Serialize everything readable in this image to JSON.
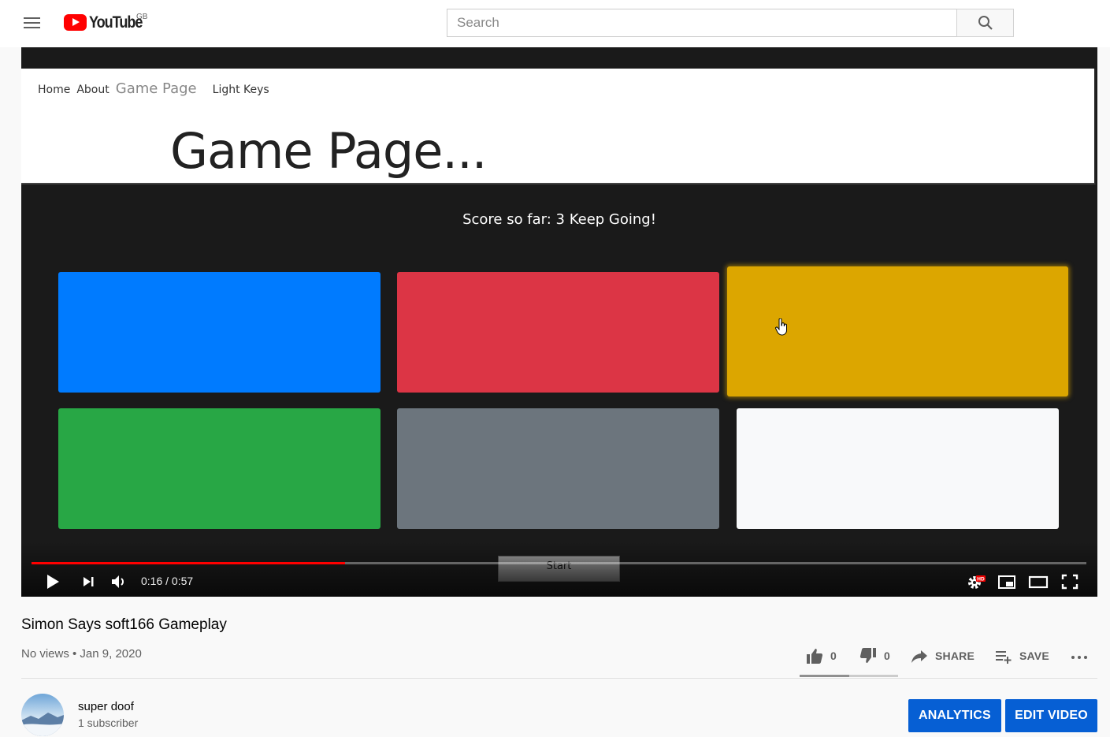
{
  "masthead": {
    "logo_text": "YouTube",
    "region": "GB",
    "search_placeholder": "Search"
  },
  "player": {
    "site_nav": [
      {
        "label": "Home"
      },
      {
        "label": "About"
      },
      {
        "label": "Game Page"
      },
      {
        "label": "Light Keys"
      }
    ],
    "site_heading": "Game Page...",
    "score_text": "Score so far: 3 Keep Going!",
    "start_label": "Start",
    "current_time": "0:16",
    "duration": "0:57",
    "time_display": "0:16 / 0:57",
    "progress_fraction": 0.297,
    "tile_colors": {
      "blue": "#007bff",
      "red": "#dc3545",
      "yellow": "#dca600",
      "green": "#28a745",
      "gray": "#6c757d",
      "white": "#f8f9fa"
    },
    "hd_badge": "HD"
  },
  "video": {
    "title": "Simon Says soft166 Gameplay",
    "meta": "No views • Jan 9, 2020",
    "likes": "0",
    "dislikes": "0",
    "share_label": "SHARE",
    "save_label": "SAVE",
    "like_ratio": 0.5
  },
  "channel": {
    "name": "super doof",
    "subscribers": "1 subscriber",
    "analytics_label": "ANALYTICS",
    "edit_label": "EDIT VIDEO"
  },
  "colors": {
    "brand_red": "#ff0000",
    "action_blue": "#065fd4"
  }
}
